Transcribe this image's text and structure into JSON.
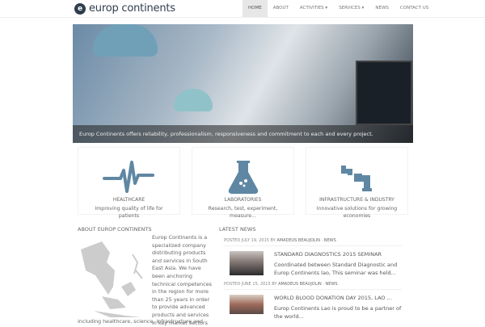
{
  "brand": {
    "name": "europ continents",
    "mark": "e"
  },
  "nav": [
    "HOME",
    "ABOUT",
    "ACTIVITIES ▾",
    "SERVICES ▾",
    "NEWS",
    "CONTACT US"
  ],
  "hero": {
    "caption": "Europ Continents offers reliability, professionalism, responsiveness and commitment to each and every project."
  },
  "cards": [
    {
      "title": "HEALTHCARE",
      "desc": "Improving quality of life for patients",
      "icon": "heartbeat-icon"
    },
    {
      "title": "LABORATORIES",
      "desc": "Research, test, experiment, measure...",
      "icon": "flask-icon"
    },
    {
      "title": "INFRASTRUCTURE & INDUSTRY",
      "desc": "Innovative solutions for growing economies",
      "icon": "pipes-icon"
    }
  ],
  "about": {
    "heading": "ABOUT EUROP CONTINENTS",
    "text": "Europ Continents is a specialized company distributing products and services in South East Asia. We have been anchoring technical competences in the region for more than 25 years in order to provide advanced products and services in key market sectors",
    "tail": "including healthcare, science, infrastructure and"
  },
  "news": {
    "heading": "LATEST NEWS",
    "items": [
      {
        "meta": "POSTED JULY 19, 2015 BY",
        "author": "AMADEUS BEAUJOLIN · NEWS",
        "title": "STANDARD DIAGNOSTICS 2015 SEMINAR",
        "excerpt": "Coordinated between Standard Diagnostic and Europ Continents lao, This seminar was held..."
      },
      {
        "meta": "POSTED JUNE 15, 2015 BY",
        "author": "AMADEUS BEAUJOLIN · NEWS",
        "title": "WORLD BLOOD DONATION DAY 2015, LAO ...",
        "excerpt": "Europ Continents Lao is proud to be a partner of the world..."
      }
    ]
  },
  "colors": {
    "icon": "#5f87a3",
    "brand": "#2f3e4e"
  }
}
